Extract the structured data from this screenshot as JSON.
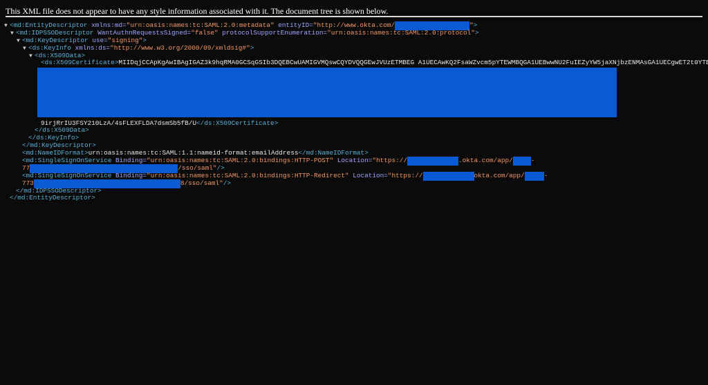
{
  "banner": "This XML file does not appear to have any style information associated with it. The document tree is shown below.",
  "toggle_glyph": "▼",
  "xml": {
    "entity_open_a": "<md:EntityDescriptor",
    "entity_attr1": " xmlns:md=",
    "entity_val1": "\"urn:oasis:names:tc:SAML:2.0:metadata\"",
    "entity_attr2": " entityID=",
    "entity_val2a": "\"http://www.okta.com/",
    "entity_val2b": "\"",
    "entity_close": ">",
    "idp_open": "<md:IDPSSODescriptor",
    "idp_attr1": " WantAuthnRequestsSigned=",
    "idp_val1": "\"false\"",
    "idp_attr2": " protocolSupportEnumeration=",
    "idp_val2": "\"urn:oasis:names:tc:SAML:2.0:protocol\"",
    "idp_close": ">",
    "kd_open": "<md:KeyDescriptor",
    "kd_attr": " use=",
    "kd_val": "\"signing\"",
    "kd_close": ">",
    "ki_open": "<ds:KeyInfo",
    "ki_attr": " xmlns:ds=",
    "ki_val": "\"http://www.w3.org/2000/09/xmldsig#\"",
    "ki_close": ">",
    "x509data_open": "<ds:X509Data>",
    "cert_open": "<ds:X509Certificate>",
    "cert_text1": "MIIDqjCCApKgAwIBAgIGAZ3k9hqRMA0GCSqGSIb3DQEBCwUAMIGVMQswCQYDVQQGEwJVUzETMBEG A1UECAwKQ2FsaWZvcm5pYTEWMBQGA1UEBwwNU2FuIEZyYW5jaXNjbzENMAsGA1UECgwET2t0YTEU",
    "cert_text_last": "9irjRrIU3FSY210LzA/4sFLEXFLDA7dsmSb5fB/U",
    "cert_close": "</ds:X509Certificate>",
    "x509data_close": "</ds:X509Data>",
    "ki_end": "</ds:KeyInfo>",
    "kd_end": "</md:KeyDescriptor>",
    "nameid_open": "<md:NameIDFormat>",
    "nameid_text": "urn:oasis:names:tc:SAML:1.1:nameid-format:emailAddress",
    "nameid_close": "</md:NameIDFormat>",
    "sso_open": "<md:SingleSignOnService",
    "sso_binding_attr": " Binding=",
    "sso1_binding_val": "\"urn:oasis:names:tc:SAML:2.0:bindings:HTTP-POST\"",
    "sso_loc_attr": " Location=",
    "sso1_loc_a": "\"https://",
    "sso1_loc_b": ".okta.com/app/",
    "sso1_loc_c": "-",
    "sso1_loc_d": "77",
    "sso1_loc_e": "/sso/saml\"",
    "sso_close": "/>",
    "sso2_binding_val": "\"urn:oasis:names:tc:SAML:2.0:bindings:HTTP-Redirect\"",
    "sso2_loc_a": "\"https://",
    "sso2_loc_b": "okta.com/app/",
    "sso2_loc_c": "-",
    "sso2_loc_d": "773",
    "sso2_loc_e": "8/sso/saml\"",
    "idp_end": "</md:IDPSSODescriptor>",
    "entity_end": "</md:EntityDescriptor>"
  },
  "colors": {
    "background": "#0b0b0b",
    "tag": "#5db0d7",
    "attribute": "#a0a6ff",
    "value": "#f29766",
    "redaction": "#0a5bd3"
  }
}
